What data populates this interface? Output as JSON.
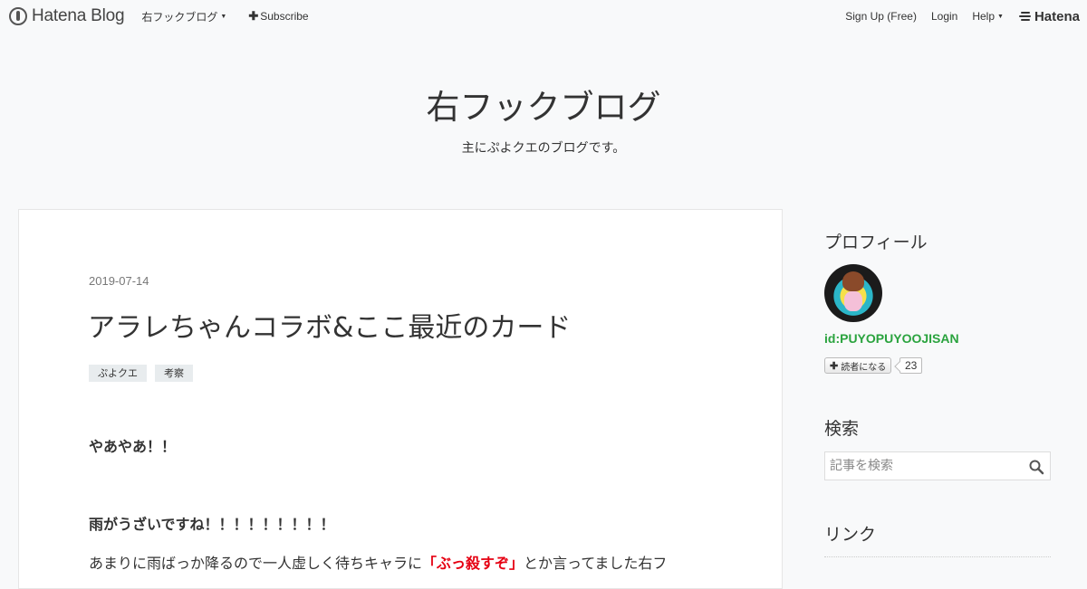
{
  "navbar": {
    "logo_text": "Hatena Blog",
    "blog_menu": "右フックブログ",
    "subscribe": "Subscribe",
    "signup": "Sign Up (Free)",
    "login": "Login",
    "help": "Help",
    "hatena": "Hatena"
  },
  "header": {
    "title": "右フックブログ",
    "description": "主にぷよクエのブログです。"
  },
  "entry": {
    "date": "2019-07-14",
    "title": "アラレちゃんコラボ&ここ最近のカード",
    "categories": [
      "ぷよクエ",
      "考察"
    ],
    "paragraph1": "やあやあ！！",
    "paragraph2": "雨がうざいですね！！！！！！！！！",
    "paragraph3_before": "あまりに雨ばっか降るので一人虚しく待ちキャラに",
    "paragraph3_highlight": "「ぶっ殺すぞ」",
    "paragraph3_after": "とか言ってました右フ"
  },
  "sidebar": {
    "profile_heading": "プロフィール",
    "profile_id": "id:PUYOPUYOOJISAN",
    "subscribe_label": "読者になる",
    "subscriber_count": "23",
    "search_heading": "検索",
    "search_placeholder": "記事を検索",
    "links_heading": "リンク"
  },
  "colors": {
    "background": "#f8f9fa",
    "profile_id": "#2aa33e",
    "highlight": "#e60012",
    "category_tag": "#e8ecee"
  }
}
